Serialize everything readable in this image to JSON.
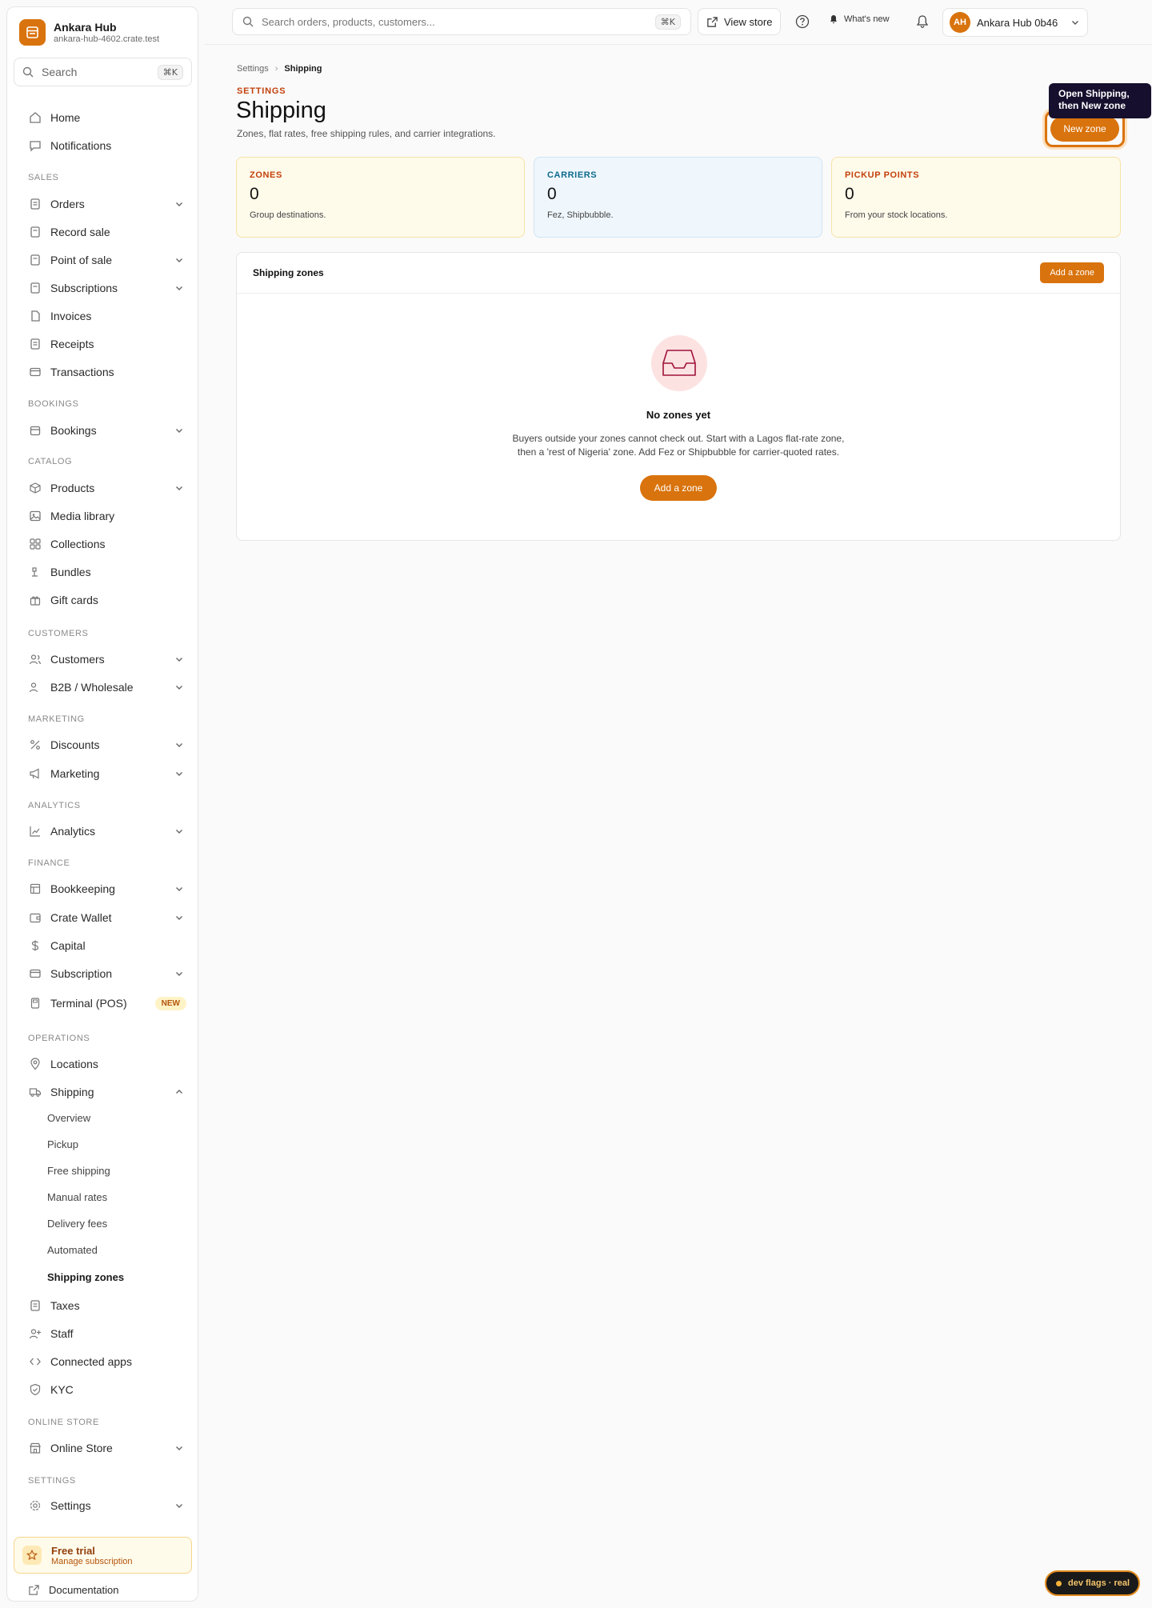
{
  "brand": {
    "name": "Ankara Hub",
    "domain": "ankara-hub-4602.crate.test"
  },
  "sidebar": {
    "search_placeholder": "Search",
    "search_shortcut": "⌘K",
    "sections": {
      "sales": "SALES",
      "bookings": "BOOKINGS",
      "catalog": "CATALOG",
      "customers": "CUSTOMERS",
      "marketing": "MARKETING",
      "analytics": "ANALYTICS",
      "finance": "FINANCE",
      "operations": "OPERATIONS",
      "online_store": "ONLINE STORE",
      "settings": "SETTINGS"
    },
    "items": {
      "home": "Home",
      "notifications": "Notifications",
      "orders": "Orders",
      "record_sale": "Record sale",
      "point_of_sale": "Point of sale",
      "subscriptions": "Subscriptions",
      "invoices": "Invoices",
      "receipts": "Receipts",
      "transactions": "Transactions",
      "bookings": "Bookings",
      "products": "Products",
      "media_library": "Media library",
      "collections": "Collections",
      "bundles": "Bundles",
      "gift_cards": "Gift cards",
      "customers": "Customers",
      "b2b": "B2B / Wholesale",
      "discounts": "Discounts",
      "marketing": "Marketing",
      "analytics": "Analytics",
      "bookkeeping": "Bookkeeping",
      "crate_wallet": "Crate Wallet",
      "capital": "Capital",
      "subscription": "Subscription",
      "terminal": "Terminal (POS)",
      "locations": "Locations",
      "shipping": "Shipping",
      "taxes": "Taxes",
      "staff": "Staff",
      "connected_apps": "Connected apps",
      "kyc": "KYC",
      "online_store": "Online Store",
      "settings": "Settings"
    },
    "terminal_badge": "NEW",
    "shipping_sub": {
      "overview": "Overview",
      "pickup": "Pickup",
      "free_shipping": "Free shipping",
      "manual_rates": "Manual rates",
      "delivery_fees": "Delivery fees",
      "automated": "Automated",
      "shipping_zones": "Shipping zones"
    },
    "trial": {
      "title": "Free trial",
      "subtitle": "Manage subscription"
    },
    "documentation": "Documentation"
  },
  "topbar": {
    "search_placeholder": "Search orders, products, customers...",
    "search_shortcut": "⌘K",
    "view_store": "View store",
    "whats_new": "What's new",
    "account_initials": "AH",
    "account_name": "Ankara Hub 0b46"
  },
  "page": {
    "breadcrumb": {
      "parent": "Settings",
      "current": "Shipping"
    },
    "eyebrow": "SETTINGS",
    "title": "Shipping",
    "subtitle": "Zones, flat rates, free shipping rules, and carrier integrations.",
    "new_zone_button": "New zone",
    "tooltip": "Open Shipping, then New zone"
  },
  "stats": [
    {
      "label": "ZONES",
      "value": "0",
      "desc": "Group destinations.",
      "color": "#c2410c",
      "bg": "#fffbeb",
      "border": "#f7e3a6"
    },
    {
      "label": "CARRIERS",
      "value": "0",
      "desc": "Fez, Shipbubble.",
      "color": "#0e6a8c",
      "bg": "#eff7fd",
      "border": "#cfe4f3"
    },
    {
      "label": "PICKUP POINTS",
      "value": "0",
      "desc": "From your stock locations.",
      "color": "#c2410c",
      "bg": "#fffbeb",
      "border": "#f7e3a6"
    }
  ],
  "zones": {
    "title": "Shipping zones",
    "add_button": "Add a zone",
    "empty_title": "No zones yet",
    "empty_line1": "Buyers outside your zones cannot check out. Start with a Lagos flat-rate zone,",
    "empty_line2": "then a 'rest of Nigeria' zone. Add Fez or Shipbubble for carrier-quoted rates.",
    "empty_button": "Add a zone"
  },
  "dev_flags": "dev flags · real",
  "colors": {
    "accent": "#d9730d",
    "tooltip_bg": "#16102e"
  }
}
